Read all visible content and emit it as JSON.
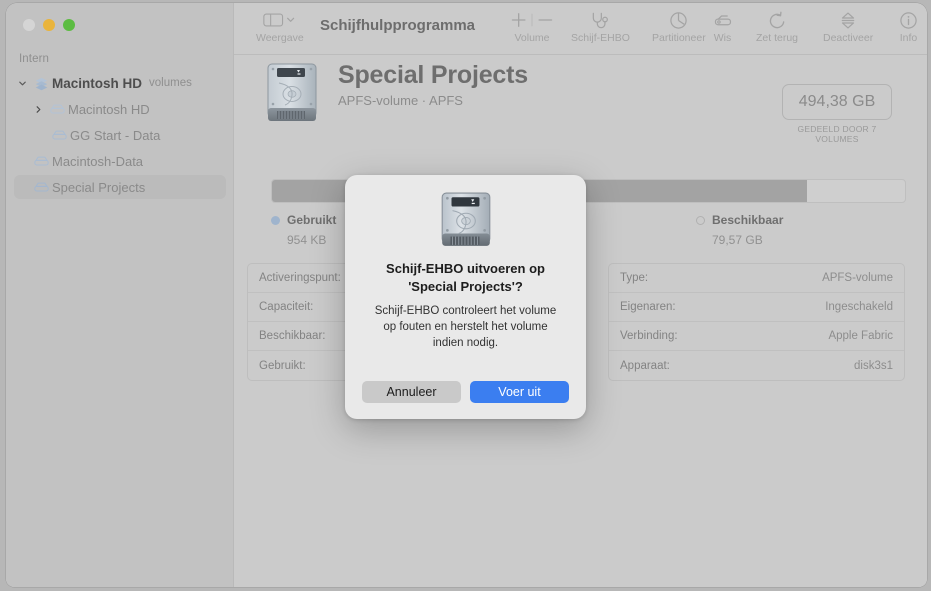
{
  "window": {
    "traffic_lights": [
      "close",
      "minimize",
      "maximize"
    ]
  },
  "toolbar": {
    "view_label": "Weergave",
    "app_title": "Schijfhulpprogramma",
    "items": [
      {
        "label": "Volume",
        "icon": "plus-minus-icon"
      },
      {
        "label": "Schijf-EHBO",
        "icon": "stethoscope-icon"
      },
      {
        "label": "Partitioneer",
        "icon": "pie-chart-icon"
      },
      {
        "label": "Wis",
        "icon": "eraser-icon"
      },
      {
        "label": "Zet terug",
        "icon": "restore-arrow-icon"
      },
      {
        "label": "Deactiveer",
        "icon": "eject-arrows-icon"
      },
      {
        "label": "Info",
        "icon": "info-circle-icon"
      }
    ]
  },
  "sidebar": {
    "section_title": "Intern",
    "items": [
      {
        "label": "Macintosh HD",
        "badge": "volumes",
        "icon": "stack-icon",
        "depth": 0,
        "disclosure": "expanded",
        "selected": false
      },
      {
        "label": "Macintosh HD",
        "badge": "",
        "icon": "volume-icon",
        "depth": 1,
        "disclosure": "collapsed",
        "selected": false
      },
      {
        "label": "GG Start - Data",
        "badge": "",
        "icon": "volume-icon",
        "depth": 2,
        "disclosure": "none",
        "selected": false
      },
      {
        "label": "Macintosh-Data",
        "badge": "",
        "icon": "volume-icon",
        "depth": 1,
        "disclosure": "none",
        "selected": false
      },
      {
        "label": "Special Projects",
        "badge": "",
        "icon": "volume-icon",
        "depth": 1,
        "disclosure": "none",
        "selected": true
      }
    ]
  },
  "main": {
    "volume_name": "Special Projects",
    "volume_subtitle": "APFS-volume · APFS",
    "volume_icon": "hard-disk-icon",
    "capacity_value": "494,38 GB",
    "capacity_caption": "GEDEELD DOOR 7 VOLUMES",
    "bar": {
      "used_percent": 84.5,
      "used_color": "#a3a3a3",
      "free_color": "#cfcfcf"
    },
    "legend": [
      {
        "title": "Gebruikt",
        "value": "954 KB",
        "swatch": "used",
        "color": "#9fb4cd"
      },
      {
        "title": "Beschikbaar",
        "value": "79,57 GB",
        "swatch": "free",
        "color": "#b0b0b0"
      }
    ],
    "info_left": [
      {
        "key": "Activeringspunt:",
        "value": ""
      },
      {
        "key": "Capaciteit:",
        "value": ""
      },
      {
        "key": "Beschikbaar:",
        "value": ""
      },
      {
        "key": "Gebruikt:",
        "value": ""
      }
    ],
    "info_right": [
      {
        "key": "Type:",
        "value": "APFS-volume"
      },
      {
        "key": "Eigenaren:",
        "value": "Ingeschakeld"
      },
      {
        "key": "Verbinding:",
        "value": "Apple Fabric"
      },
      {
        "key": "Apparaat:",
        "value": "disk3s1"
      }
    ]
  },
  "dialog": {
    "icon": "hard-disk-icon",
    "title": "Schijf-EHBO uitvoeren op 'Special Projects'?",
    "body": "Schijf-EHBO controleert het volume op fouten en herstelt het volume indien nodig.",
    "cancel_label": "Annuleer",
    "confirm_label": "Voer uit",
    "confirm_color": "#3b7ef0"
  }
}
